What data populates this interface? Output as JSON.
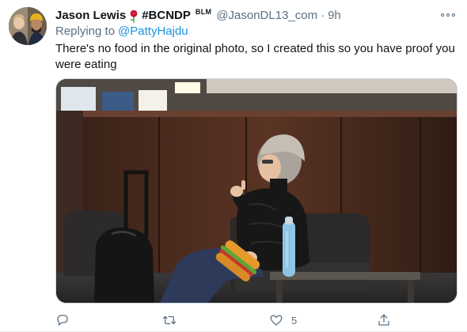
{
  "tweet": {
    "author": {
      "display_name": "Jason Lewis",
      "party_tag": "#BCNDP",
      "badge": "BLM",
      "handle": "@JasonDL13_com",
      "separator": "·",
      "time": "9h"
    },
    "reply": {
      "prefix": "Replying to",
      "mention": "@PattyHajdu"
    },
    "text": "There's no food in the original photo, so I created this so you have proof you were eating",
    "media": {
      "alt_icon": "photo-image"
    },
    "actions": {
      "reply_count": "",
      "retweet_count": "",
      "like_count": "5",
      "share_count": ""
    }
  },
  "colors": {
    "text_primary": "#0f1419",
    "text_secondary": "#5b7083",
    "link": "#1b95e0",
    "rose": "#d0021b",
    "bottle": "#8ec5e6",
    "food_bun": "#e59a2b",
    "food_filling": "#5aa832"
  },
  "icons": {
    "rose": "rose-emoji-icon",
    "more": "more-options-icon",
    "reply": "reply-icon",
    "retweet": "retweet-icon",
    "like": "heart-icon",
    "share": "share-icon"
  }
}
